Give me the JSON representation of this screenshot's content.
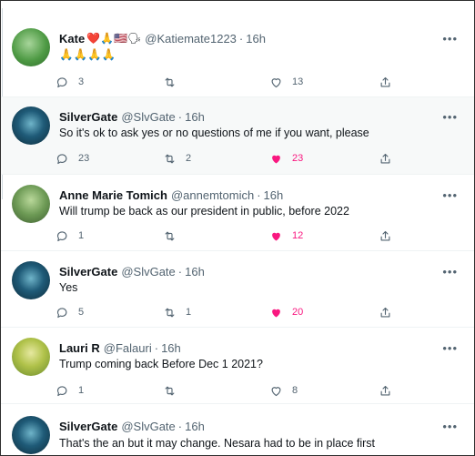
{
  "tweets": [
    {
      "name": "Kate",
      "emojis": "❤️🙏🇺🇸🗣",
      "handle": "@Katiemate1223",
      "sep": "·",
      "time": "16h",
      "text": "🙏🙏🙏🙏",
      "replies": "3",
      "retweets": "",
      "likes": "13",
      "liked": false,
      "avatar_color": "#3f8a3a"
    },
    {
      "name": "SilverGate",
      "emojis": "",
      "handle": "@SlvGate",
      "sep": "·",
      "time": "16h",
      "text": "So it's ok to ask yes or no questions of me if you want, please",
      "replies": "23",
      "retweets": "2",
      "likes": "23",
      "liked": true,
      "avatar_color": "#1f5b78"
    },
    {
      "name": "Anne Marie Tomich",
      "emojis": "",
      "handle": "@annemtomich",
      "sep": "·",
      "time": "16h",
      "text": "Will trump be back as our president in public, before 2022",
      "replies": "1",
      "retweets": "",
      "likes": "12",
      "liked": true,
      "avatar_color": "#5f8f4e"
    },
    {
      "name": "SilverGate",
      "emojis": "",
      "handle": "@SlvGate",
      "sep": "·",
      "time": "16h",
      "text": "Yes",
      "replies": "5",
      "retweets": "1",
      "likes": "20",
      "liked": true,
      "avatar_color": "#1f5b78"
    },
    {
      "name": "Lauri R",
      "emojis": "",
      "handle": "@Falauri",
      "sep": "·",
      "time": "16h",
      "text": "Trump coming back Before Dec 1 2021?",
      "replies": "1",
      "retweets": "",
      "likes": "8",
      "liked": false,
      "avatar_color": "#9aa83c"
    },
    {
      "name": "SilverGate",
      "emojis": "",
      "handle": "@SlvGate",
      "sep": "·",
      "time": "16h",
      "text": "That's the an but it may change. Nesara had to be in place first",
      "replies": "",
      "retweets": "",
      "likes": "",
      "liked": false,
      "avatar_color": "#1f5b78"
    }
  ],
  "more_label": "•••",
  "colors": {
    "like_active": "#f91880",
    "icon": "#536471"
  }
}
